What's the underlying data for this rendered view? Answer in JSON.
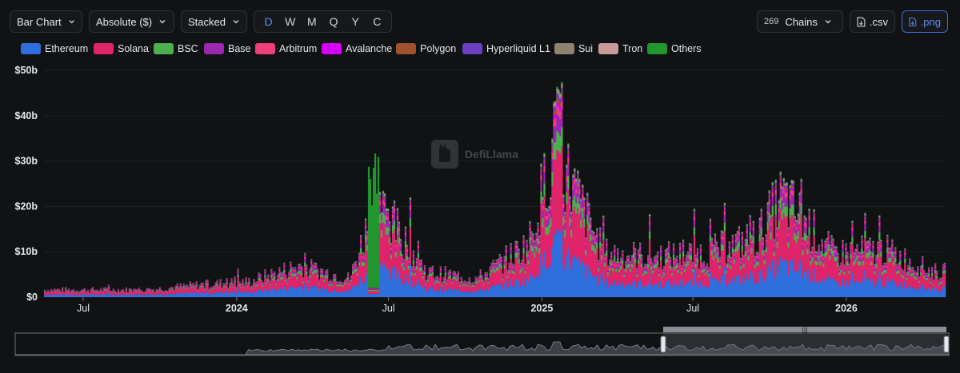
{
  "toolbar": {
    "chart_type_label": "Bar Chart",
    "value_mode_label": "Absolute ($)",
    "stack_mode_label": "Stacked",
    "periods": [
      "D",
      "W",
      "M",
      "Q",
      "Y",
      "C"
    ],
    "active_period": "D",
    "chains_count": "269",
    "chains_label": "Chains",
    "csv_label": ".csv",
    "png_label": ".png"
  },
  "watermark": "DefiLlama",
  "colors": {
    "accent": "#5c8ff0",
    "background": "#111214"
  },
  "chart_data": {
    "type": "bar",
    "stacked": true,
    "x_ticks": [
      "Jul",
      "2024",
      "Jul",
      "2025",
      "Jul",
      "2026"
    ],
    "y_ticks": [
      "$0",
      "$10b",
      "$20b",
      "$30b",
      "$40b",
      "$50b"
    ],
    "ylim": [
      0,
      50
    ],
    "y_unit": "$b",
    "grid": true,
    "legend_position": "top-left",
    "series": [
      {
        "name": "Ethereum",
        "color": "#2f6fdd"
      },
      {
        "name": "Solana",
        "color": "#e0246a"
      },
      {
        "name": "BSC",
        "color": "#4caf50"
      },
      {
        "name": "Base",
        "color": "#9c27b0"
      },
      {
        "name": "Arbitrum",
        "color": "#ef3f7a"
      },
      {
        "name": "Avalanche",
        "color": "#d500f9"
      },
      {
        "name": "Polygon",
        "color": "#a0522d"
      },
      {
        "name": "Hyperliquid L1",
        "color": "#6a3fc1"
      },
      {
        "name": "Sui",
        "color": "#8e8270"
      },
      {
        "name": "Tron",
        "color": "#c99a9a"
      },
      {
        "name": "Others",
        "color": "#22962f"
      }
    ],
    "period_totals_approx": [
      {
        "x": "2023-06",
        "total": 2.5
      },
      {
        "x": "2023-09",
        "total": 2.5
      },
      {
        "x": "2023-11",
        "total": 4
      },
      {
        "x": "2024-01",
        "total": 5
      },
      {
        "x": "2024-03",
        "total": 10
      },
      {
        "x": "2024-05",
        "total": 6
      },
      {
        "x": "2024-06",
        "total": 31
      },
      {
        "x": "2024-08",
        "total": 8
      },
      {
        "x": "2024-10",
        "total": 6
      },
      {
        "x": "2024-12",
        "total": 17
      },
      {
        "x": "2025-01",
        "total": 48
      },
      {
        "x": "2025-03",
        "total": 14
      },
      {
        "x": "2025-05",
        "total": 13
      },
      {
        "x": "2025-07",
        "total": 14
      },
      {
        "x": "2025-09",
        "total": 19
      },
      {
        "x": "2025-10",
        "total": 32
      },
      {
        "x": "2025-12",
        "total": 14
      },
      {
        "x": "2026-02",
        "total": 15
      },
      {
        "x": "2026-04",
        "total": 8
      }
    ]
  }
}
